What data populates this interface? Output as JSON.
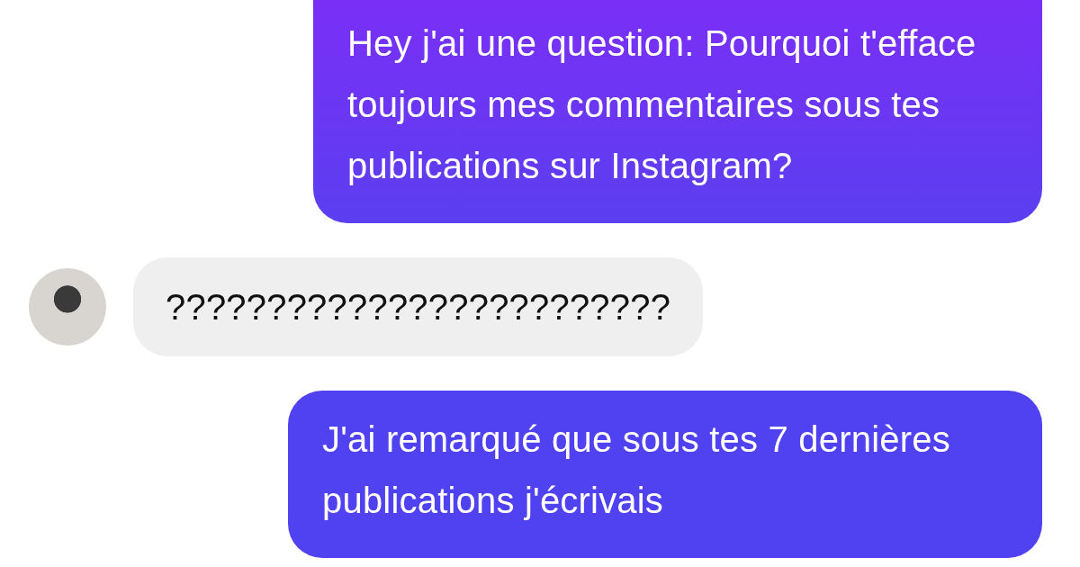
{
  "messages": [
    {
      "kind": "sent",
      "text": "Hey j'ai une question: Pourquoi t'efface toujours mes commentaires sous tes publications sur Instagram?"
    },
    {
      "kind": "received",
      "text": "?????????????????????????"
    },
    {
      "kind": "sent",
      "text": "J'ai remarqué que sous tes 7 dernières publications j'écrivais"
    }
  ]
}
